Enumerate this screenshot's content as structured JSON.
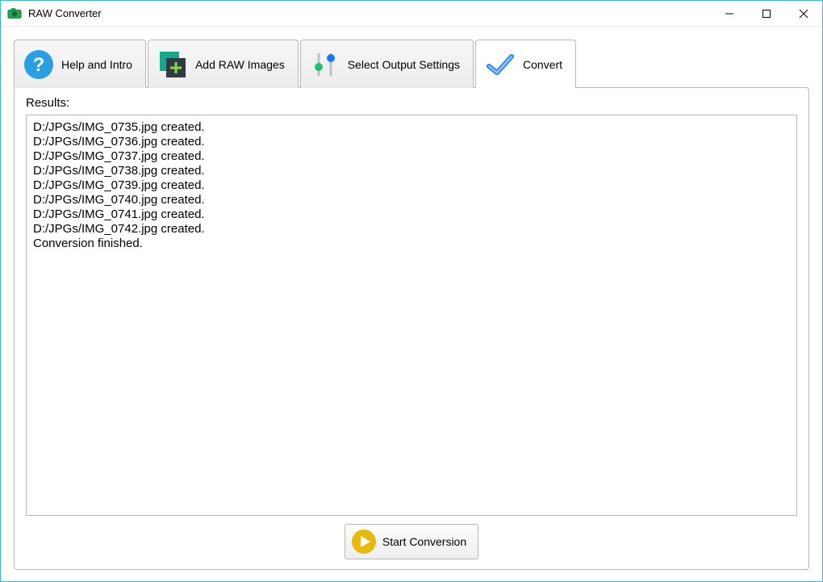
{
  "window": {
    "title": "RAW Converter"
  },
  "tabs": {
    "help": {
      "label": "Help and Intro"
    },
    "add": {
      "label": "Add RAW Images"
    },
    "output": {
      "label": "Select Output Settings"
    },
    "convert": {
      "label": "Convert"
    }
  },
  "panel": {
    "results_label": "Results:",
    "results_text": "D:/JPGs/IMG_0735.jpg created.\nD:/JPGs/IMG_0736.jpg created.\nD:/JPGs/IMG_0737.jpg created.\nD:/JPGs/IMG_0738.jpg created.\nD:/JPGs/IMG_0739.jpg created.\nD:/JPGs/IMG_0740.jpg created.\nD:/JPGs/IMG_0741.jpg created.\nD:/JPGs/IMG_0742.jpg created.\nConversion finished.",
    "start_label": "Start Conversion"
  }
}
